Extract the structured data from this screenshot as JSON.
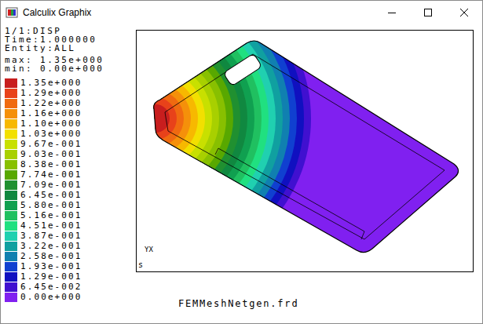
{
  "window": {
    "title": "Calculix Graphix"
  },
  "info": [
    "1/1:DISP",
    "Time:1.000000",
    "Entity:ALL"
  ],
  "range": [
    "max: 1.35e+000",
    "min: 0.00e+000"
  ],
  "legend": [
    {
      "value": "1.35e+000",
      "color": "#c81e1e"
    },
    {
      "value": "1.29e+000",
      "color": "#e8421a"
    },
    {
      "value": "1.22e+000",
      "color": "#f06a10"
    },
    {
      "value": "1.16e+000",
      "color": "#f5900a"
    },
    {
      "value": "1.10e+000",
      "color": "#f7b800"
    },
    {
      "value": "1.03e+000",
      "color": "#f2e000"
    },
    {
      "value": "9.67e-001",
      "color": "#c8e000"
    },
    {
      "value": "9.03e-001",
      "color": "#a8d000"
    },
    {
      "value": "8.38e-001",
      "color": "#88c000"
    },
    {
      "value": "7.74e-001",
      "color": "#58a800"
    },
    {
      "value": "7.09e-001",
      "color": "#209030"
    },
    {
      "value": "6.45e-001",
      "color": "#108840"
    },
    {
      "value": "5.80e-001",
      "color": "#10a050"
    },
    {
      "value": "5.16e-001",
      "color": "#20c060"
    },
    {
      "value": "4.51e-001",
      "color": "#20e080"
    },
    {
      "value": "3.87e-001",
      "color": "#20d0b0"
    },
    {
      "value": "3.22e-001",
      "color": "#10a0a0"
    },
    {
      "value": "2.58e-001",
      "color": "#1080b0"
    },
    {
      "value": "1.93e-001",
      "color": "#1040d0"
    },
    {
      "value": "1.29e-001",
      "color": "#1010c0"
    },
    {
      "value": "6.45e-002",
      "color": "#4010d0"
    },
    {
      "value": "0.00e+000",
      "color": "#8020f0"
    }
  ],
  "viewport": {
    "axis_label": "YX",
    "corner_label": "s"
  },
  "file": "FEMMeshNetgen.frd"
}
